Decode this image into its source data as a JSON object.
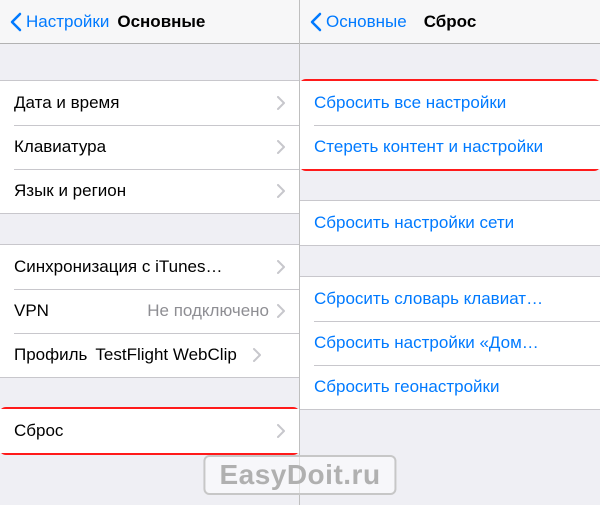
{
  "left": {
    "nav": {
      "back": "Настройки",
      "title": "Основные"
    },
    "group1": [
      {
        "label": "Дата и время",
        "name": "row-date-time"
      },
      {
        "label": "Клавиатура",
        "name": "row-keyboard"
      },
      {
        "label": "Язык и регион",
        "name": "row-language-region"
      }
    ],
    "group2": [
      {
        "label": "Синхронизация с iTunes…",
        "name": "row-itunes-sync"
      },
      {
        "label": "VPN",
        "value": "Не подключено",
        "name": "row-vpn"
      },
      {
        "label": "Профиль",
        "value": "TestFlight WebClip",
        "name": "row-profile"
      }
    ],
    "group3": [
      {
        "label": "Сброс",
        "name": "row-reset"
      }
    ]
  },
  "right": {
    "nav": {
      "back": "Основные",
      "title": "Сброс"
    },
    "group1": [
      {
        "label": "Сбросить все настройки",
        "name": "action-reset-all-settings"
      },
      {
        "label": "Стереть контент и настройки",
        "name": "action-erase-all-content"
      }
    ],
    "group2": [
      {
        "label": "Сбросить настройки сети",
        "name": "action-reset-network"
      }
    ],
    "group3": [
      {
        "label": "Сбросить словарь клавиат…",
        "name": "action-reset-keyboard-dict"
      },
      {
        "label": "Сбросить настройки «Дом…",
        "name": "action-reset-home-layout"
      },
      {
        "label": "Сбросить геонастройки",
        "name": "action-reset-location-privacy"
      }
    ]
  },
  "watermark": "EasyDoit.ru"
}
